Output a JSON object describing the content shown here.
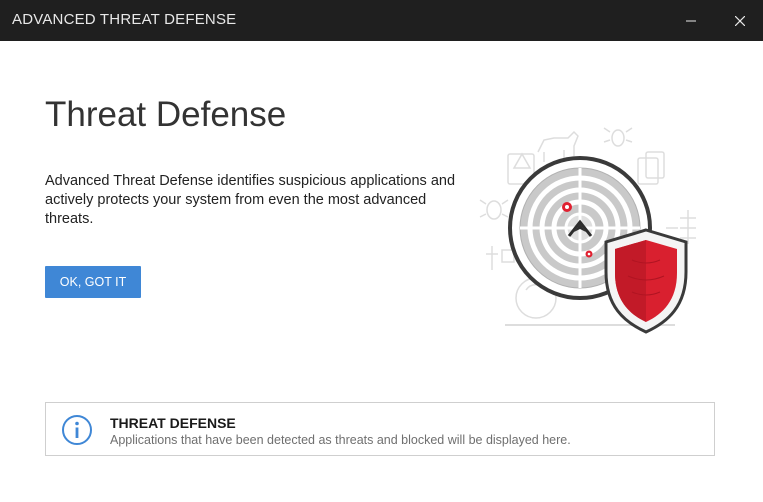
{
  "window": {
    "title": "ADVANCED THREAT DEFENSE",
    "minimize_icon": "minimize-icon",
    "close_icon": "close-icon"
  },
  "main": {
    "heading": "Threat Defense",
    "description": "Advanced Threat Defense identifies suspicious applications and actively protects your system from even the most advanced threats.",
    "ok_button_label": "OK, GOT IT"
  },
  "info_panel": {
    "icon": "info-icon",
    "title": "THREAT DEFENSE",
    "text": "Applications that have been detected as threats and blocked will be displayed here."
  },
  "colors": {
    "titlebar": "#1f1f1f",
    "accent_blue": "#3f87d6",
    "shield_red": "#d9202f"
  }
}
